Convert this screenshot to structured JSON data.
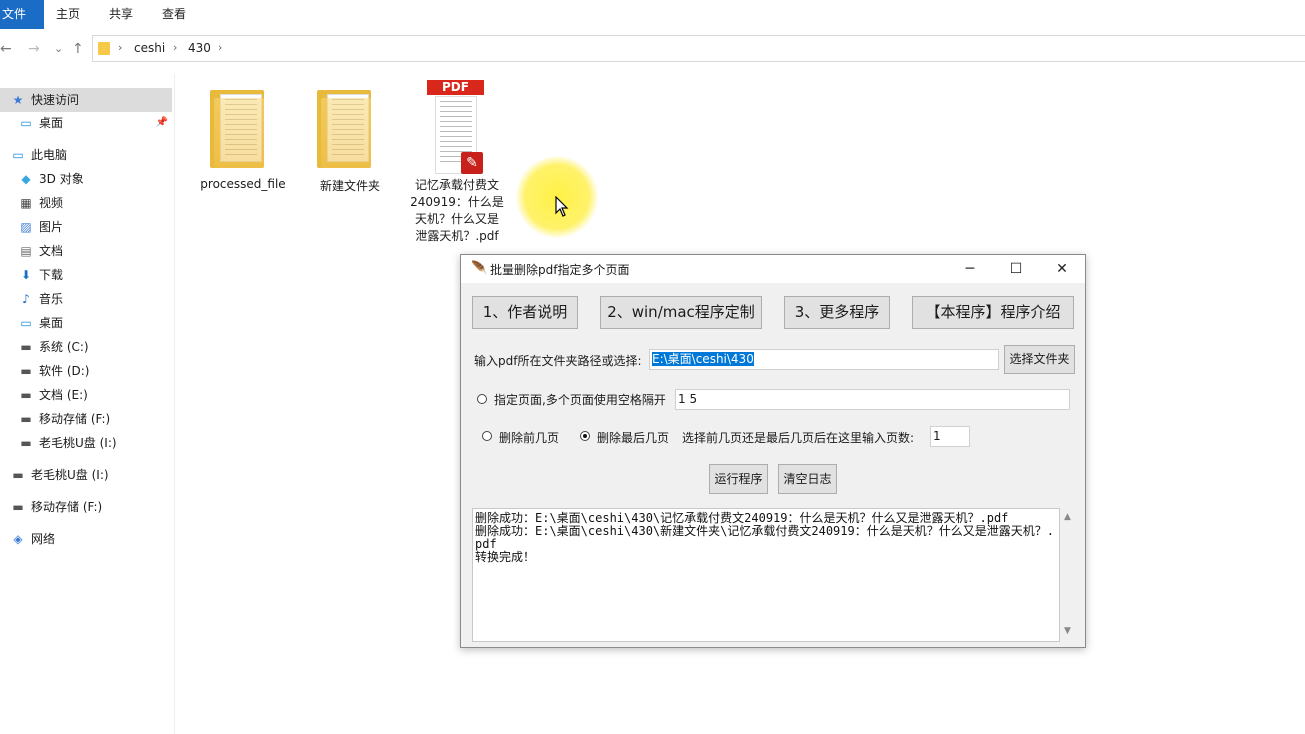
{
  "ribbon": {
    "tabs": [
      "文件",
      "主页",
      "共享",
      "查看"
    ]
  },
  "nav": {
    "back": "←",
    "forward": "→",
    "recent": "⌄",
    "up": "↑",
    "breadcrumbs": [
      "ceshi",
      "430"
    ],
    "separator": "›"
  },
  "sidebar": {
    "items": [
      {
        "label": "快速访问",
        "icon": "star-icon",
        "glyph": "★"
      },
      {
        "label": "桌面",
        "icon": "desktop-icon",
        "glyph": "▭"
      },
      {
        "label": "此电脑",
        "icon": "computer-icon",
        "glyph": "▭"
      },
      {
        "label": "3D 对象",
        "icon": "cube-icon",
        "glyph": "◆"
      },
      {
        "label": "视频",
        "icon": "video-icon",
        "glyph": "▦"
      },
      {
        "label": "图片",
        "icon": "picture-icon",
        "glyph": "▨"
      },
      {
        "label": "文档",
        "icon": "document-icon",
        "glyph": "▤"
      },
      {
        "label": "下载",
        "icon": "download-icon",
        "glyph": "⬇"
      },
      {
        "label": "音乐",
        "icon": "music-icon",
        "glyph": "♪"
      },
      {
        "label": "桌面",
        "icon": "desktop-icon",
        "glyph": "▭"
      },
      {
        "label": "系统 (C:)",
        "icon": "drive-icon",
        "glyph": "▬"
      },
      {
        "label": "软件 (D:)",
        "icon": "drive-icon",
        "glyph": "▬"
      },
      {
        "label": "文档 (E:)",
        "icon": "drive-icon",
        "glyph": "▬"
      },
      {
        "label": "移动存储 (F:)",
        "icon": "drive-icon",
        "glyph": "▬"
      },
      {
        "label": "老毛桃U盘 (I:)",
        "icon": "drive-icon",
        "glyph": "▬"
      },
      {
        "label": "老毛桃U盘 (I:)",
        "icon": "usb-drive-icon",
        "glyph": "▬"
      },
      {
        "label": "移动存储 (F:)",
        "icon": "usb-drive-icon",
        "glyph": "▬"
      },
      {
        "label": "网络",
        "icon": "network-icon",
        "glyph": "◈"
      }
    ],
    "pin": "📌"
  },
  "files": [
    {
      "name": "processed_file",
      "type": "folder"
    },
    {
      "name": "新建文件夹",
      "type": "folder"
    },
    {
      "name": "记忆承载付费文240919：什么是天机？什么又是泄露天机？.pdf",
      "type": "pdf",
      "lines": [
        "记忆承载付费文",
        "240919：什么是",
        "天机？什么又是",
        "泄露天机？.pdf"
      ],
      "banner": "PDF"
    }
  ],
  "dialog": {
    "title": "批量删除pdf指定多个页面",
    "controls": {
      "minimize": "─",
      "maximize": "☐",
      "close": "✕"
    },
    "top_buttons": [
      "1、作者说明",
      "2、win/mac程序定制",
      "3、更多程序",
      "【本程序】程序介绍"
    ],
    "path_label": "输入pdf所在文件夹路径或选择:",
    "path_value": "E:\\桌面\\ceshi\\430",
    "choose_folder": "选择文件夹",
    "specify_label": "指定页面,多个页面使用空格隔开",
    "specify_value": "1 5",
    "delete_front": "删除前几页",
    "delete_last": "删除最后几页",
    "count_label": "选择前几页还是最后几页后在这里输入页数:",
    "count_value": "1",
    "run": "运行程序",
    "clear_log": "清空日志",
    "log_lines": [
      "删除成功：E:\\桌面\\ceshi\\430\\记忆承载付费文240919：什么是天机？什么又是泄露天机？.pdf",
      "删除成功：E:\\桌面\\ceshi\\430\\新建文件夹\\记忆承载付费文240919：什么是天机？什么又是泄露天机？.pdf",
      "转换完成！"
    ],
    "selected_mode": "delete_last"
  },
  "colors": {
    "accent": "#1a6cc4",
    "pdf_red": "#d9271c",
    "highlight": "#0078d7"
  }
}
